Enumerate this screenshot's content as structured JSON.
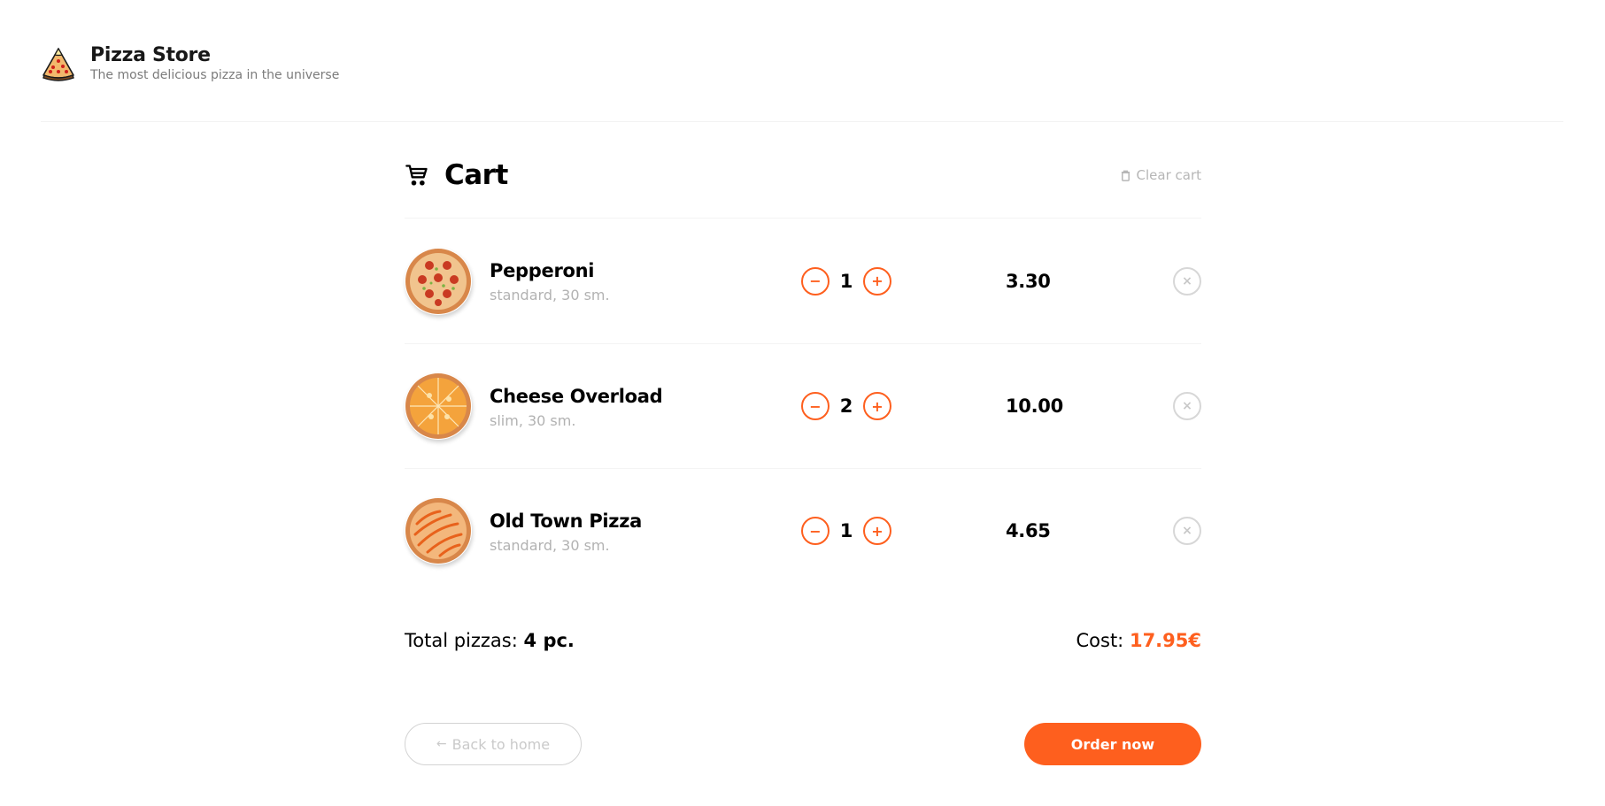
{
  "header": {
    "title": "Pizza Store",
    "subtitle": "The most delicious pizza in the universe"
  },
  "cart": {
    "title": "Cart",
    "clear_label": "Clear cart",
    "items": [
      {
        "name": "Pepperoni",
        "desc": "standard, 30 sm.",
        "qty": "1",
        "price": "3.30",
        "image": "pepperoni-pizza"
      },
      {
        "name": "Cheese Overload",
        "desc": "slim, 30 sm.",
        "qty": "2",
        "price": "10.00",
        "image": "cheese-pizza"
      },
      {
        "name": "Old Town Pizza",
        "desc": "standard, 30 sm.",
        "qty": "1",
        "price": "4.65",
        "image": "old-town-pizza"
      }
    ],
    "minus_icon": "−",
    "plus_icon": "+",
    "remove_icon": "×"
  },
  "summary": {
    "total_label": "Total pizzas:",
    "total_value": "4 pc.",
    "cost_label": "Cost:",
    "cost_value": "17.95€"
  },
  "actions": {
    "back_arrow": "←",
    "back_label": "Back to home",
    "order_label": "Order now"
  },
  "colors": {
    "accent": "#fe5f1e",
    "muted": "#b2b2b2"
  }
}
